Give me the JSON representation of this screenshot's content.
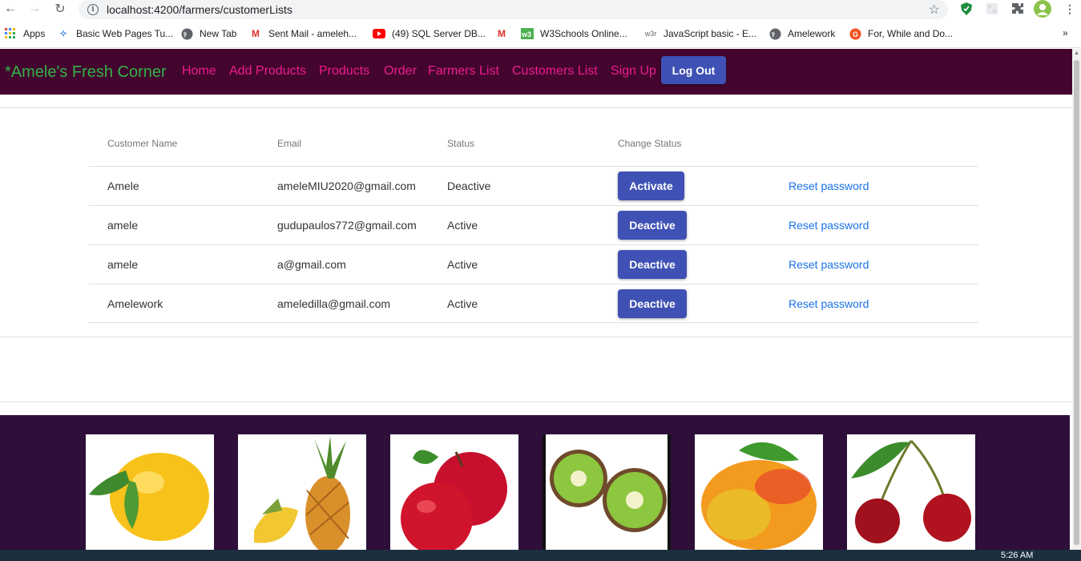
{
  "browser": {
    "url": "localhost:4200/farmers/customerLists",
    "bookmarks": [
      {
        "label": "Apps",
        "icon": "apps-grid-icon"
      },
      {
        "label": "Basic Web Pages Tu...",
        "icon": "bookmark-favicon"
      },
      {
        "label": "New Tab",
        "icon": "globe-icon"
      },
      {
        "label": "Sent Mail - ameleh...",
        "icon": "gmail-icon"
      },
      {
        "label": "(49) SQL Server DB...",
        "icon": "youtube-icon"
      },
      {
        "label": "",
        "icon": "gmail-icon"
      },
      {
        "label": "W3Schools Online...",
        "icon": "w3schools-icon"
      },
      {
        "label": "JavaScript basic - E...",
        "icon": "w3resource-icon"
      },
      {
        "label": "Amelework",
        "icon": "globe-icon"
      },
      {
        "label": "For, While and Do...",
        "icon": "guru-icon"
      }
    ]
  },
  "navbar": {
    "brand": "*Amele's Fresh Corner",
    "links": [
      "Home",
      "Add Products",
      "Products",
      "Order",
      "Farmers List",
      "Customers List",
      "Sign Up"
    ],
    "logout_label": "Log Out"
  },
  "table": {
    "headers": [
      "Customer Name",
      "Email",
      "Status",
      "Change Status"
    ],
    "rows": [
      {
        "name": "Amele",
        "email": "ameleMIU2020@gmail.com",
        "status": "Deactive",
        "action": "Activate",
        "reset": "Reset password"
      },
      {
        "name": "amele",
        "email": "gudupaulos772@gmail.com",
        "status": "Active",
        "action": "Deactive",
        "reset": "Reset password"
      },
      {
        "name": "amele",
        "email": "a@gmail.com",
        "status": "Active",
        "action": "Deactive",
        "reset": "Reset password"
      },
      {
        "name": "Amelework",
        "email": "ameledilla@gmail.com",
        "status": "Active",
        "action": "Deactive",
        "reset": "Reset password"
      }
    ]
  },
  "footer": {
    "images": [
      "lemon",
      "pineapple",
      "apples",
      "kiwi",
      "mango",
      "cherries"
    ]
  },
  "taskbar": {
    "time": "5:26 AM"
  },
  "colors": {
    "navbar_bg": "#43052e",
    "brand": "#33b249",
    "nav_link": "#ed1b8c",
    "button": "#3f51b5",
    "link": "#1a73e8",
    "footer_bg": "#2d0f3a"
  }
}
